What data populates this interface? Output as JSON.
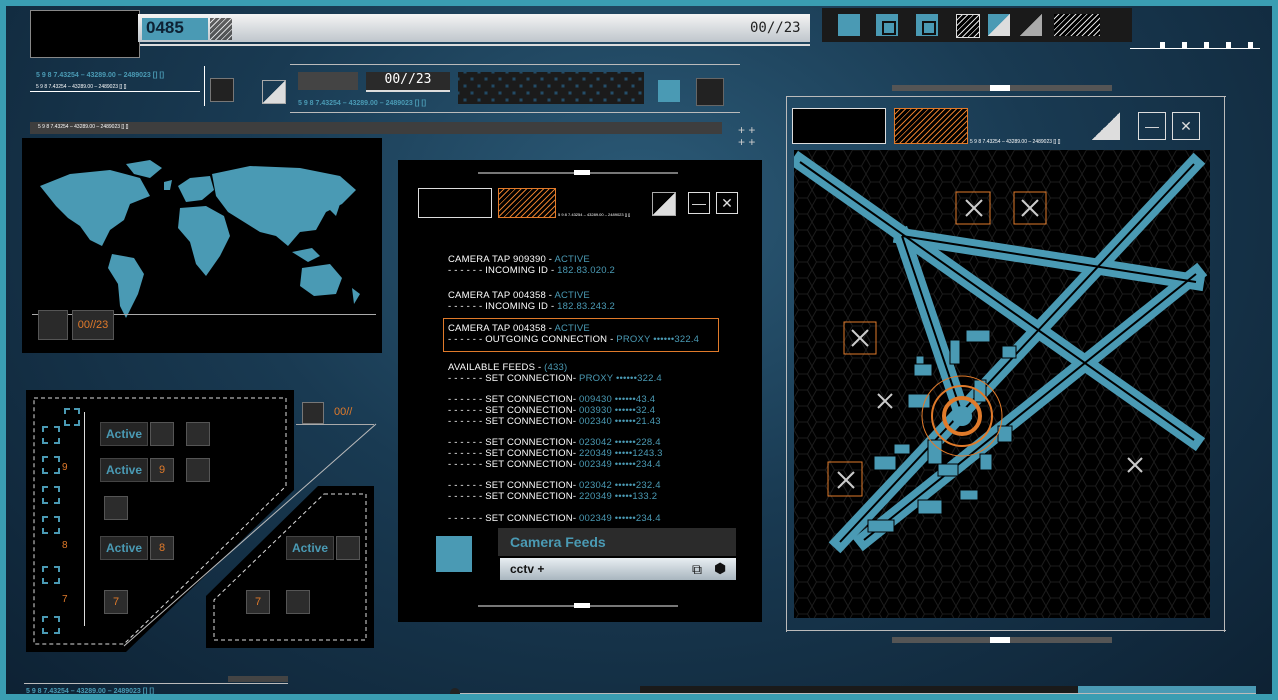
{
  "top_bar": {
    "counter": "0485",
    "counter_right": "00//23"
  },
  "header_row2": {
    "code_a": "5 9 8 7.43254 – 43289.00 – 2489023 [] []",
    "code_small": "5 9 8 7.43254 – 43289.00 – 2489023 [] []",
    "code_b": "5 9 8 7.43254 – 43289.00 – 2489023 [] []",
    "counter": "00//23"
  },
  "header_row3": {
    "code": "5 9 8 7.43254 – 43289.00 – 2489023 [] []"
  },
  "map_panel": {
    "counter": "00//23"
  },
  "grid_panel": {
    "counter": "00//",
    "active_label": "Active",
    "numbers": [
      "9",
      "8",
      "7"
    ],
    "right_active_label": "Active",
    "right_number": "7"
  },
  "feeds_panel": {
    "code": "5 9 8 7.43254 – 43289.00 – 2489023 [] []",
    "taps": [
      {
        "label": "CAMERA TAP 909390 - ",
        "status": "ACTIVE",
        "sub": "- - - - - - INCOMING ID - ",
        "sub_val": "182.83.020.2"
      },
      {
        "label": "CAMERA TAP 004358 - ",
        "status": "ACTIVE",
        "sub": "- - - - - - INCOMING ID - ",
        "sub_val": "182.83.243.2"
      },
      {
        "label": "CAMERA TAP 004358 - ",
        "status": "ACTIVE",
        "sub": "- - - - - - OUTGOING CONNECTION - ",
        "sub_val": "PROXY ••••••322.4"
      }
    ],
    "available_label": "AVAILABLE FEEDS - ",
    "available_count": "(433)",
    "connections": [
      {
        "t": "- - - - - - SET CONNECTION- ",
        "v": "PROXY ••••••322.4"
      },
      {
        "t": "- - - - - - SET CONNECTION- ",
        "v": "009430 ••••••43.4"
      },
      {
        "t": "- - - - - - SET CONNECTION- ",
        "v": "003930 ••••••32.4"
      },
      {
        "t": "- - - - - - SET CONNECTION- ",
        "v": "002340 ••••••21.43"
      },
      {
        "t": "- - - - - - SET CONNECTION- ",
        "v": "023042 ••••••228.4"
      },
      {
        "t": "- - - - - - SET CONNECTION- ",
        "v": "220349 •••••1243.3"
      },
      {
        "t": "- - - - - - SET CONNECTION- ",
        "v": "002349 ••••••234.4"
      },
      {
        "t": "- - - - - - SET CONNECTION- ",
        "v": "023042 ••••••232.4"
      },
      {
        "t": "- - - - - - SET CONNECTION- ",
        "v": "220349 •••••133.2"
      },
      {
        "t": "- - - - - - SET CONNECTION- ",
        "v": "002349 ••••••234.4"
      }
    ],
    "camera_feeds_title": "Camera Feeds",
    "cctv_label": "cctv +"
  },
  "radar_panel": {
    "code": "5 9 8 7.43254 – 43289.00 – 2489023 [] []"
  },
  "footer": {
    "code": "5 9 8 7.43254 – 43289.00 – 2489023 [] []"
  }
}
